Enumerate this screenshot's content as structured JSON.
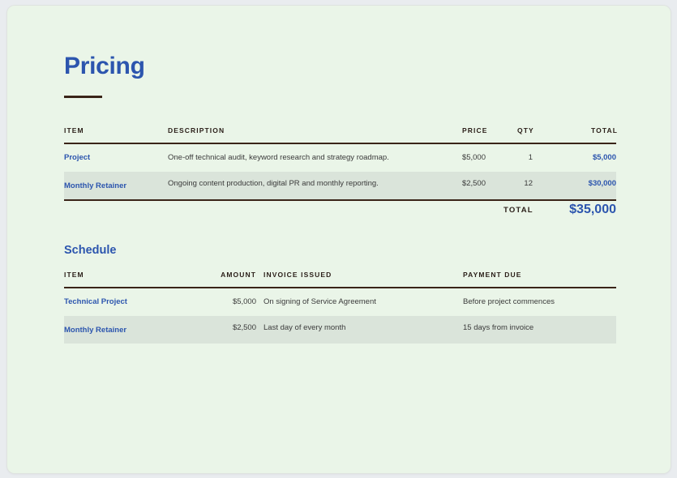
{
  "title": "Pricing",
  "pricing": {
    "headers": {
      "item": "ITEM",
      "description": "DESCRIPTION",
      "price": "PRICE",
      "qty": "QTY",
      "total": "TOTAL"
    },
    "rows": [
      {
        "item": "Project",
        "description": "One-off technical audit, keyword research and strategy roadmap.",
        "price": "$5,000",
        "qty": "1",
        "total": "$5,000"
      },
      {
        "item": "Monthly Retainer",
        "description": "Ongoing content production, digital PR and monthly reporting.",
        "price": "$2,500",
        "qty": "12",
        "total": "$30,000"
      }
    ],
    "total_label": "TOTAL",
    "total_value": "$35,000"
  },
  "schedule": {
    "title": "Schedule",
    "headers": {
      "item": "ITEM",
      "amount": "AMOUNT",
      "invoice": "INVOICE ISSUED",
      "payment": "PAYMENT DUE"
    },
    "rows": [
      {
        "item": "Technical Project",
        "amount": "$5,000",
        "invoice": "On signing of Service Agreement",
        "payment": "Before project commences"
      },
      {
        "item": "Monthly Retainer",
        "amount": "$2,500",
        "invoice": "Last day of every month",
        "payment": "15 days from invoice"
      }
    ]
  },
  "colors": {
    "accent": "#2c55ae",
    "rule": "#3a2418",
    "background": "#eaf5e8",
    "row_alt": "#dae4da"
  }
}
